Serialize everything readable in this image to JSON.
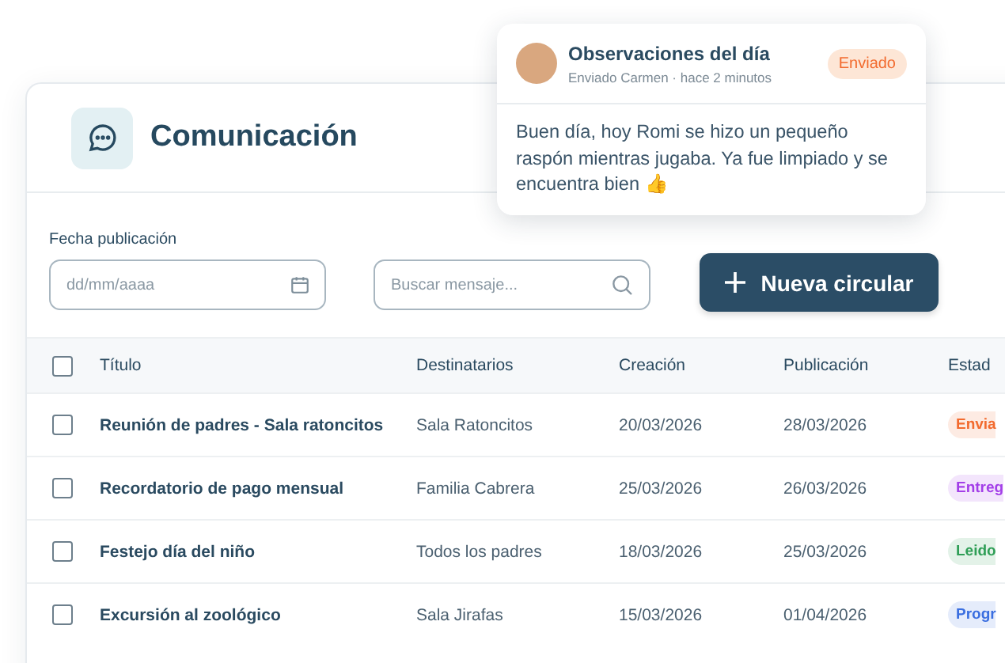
{
  "header": {
    "title": "Comunicación"
  },
  "filters": {
    "date_label": "Fecha publicación",
    "date_placeholder": "dd/mm/aaaa",
    "search_placeholder": "Buscar mensaje...",
    "new_button": "Nueva circular"
  },
  "table": {
    "select_all_checked": false,
    "columns": [
      "Título",
      "Destinatarios",
      "Creación",
      "Publicación",
      "Estad"
    ],
    "rows": [
      {
        "checked": false,
        "title": "Reunión de padres - Sala ratoncitos",
        "recipients": "Sala Ratoncitos",
        "created": "20/03/2026",
        "published": "28/03/2026",
        "status": "Envia",
        "color": "#f26b2f"
      },
      {
        "checked": false,
        "title": "Recordatorio de pago mensual",
        "recipients": "Familia Cabrera",
        "created": "25/03/2026",
        "published": "26/03/2026",
        "status": "Entreg",
        "color": "#a33ee8"
      },
      {
        "checked": false,
        "title": "Festejo día del niño",
        "recipients": "Todos los padres",
        "created": "18/03/2026",
        "published": "25/03/2026",
        "status": "Leido",
        "color": "#2f9e56"
      },
      {
        "checked": false,
        "title": "Excursión al zoológico",
        "recipients": "Sala Jirafas",
        "created": "15/03/2026",
        "published": "01/04/2026",
        "status": "Progr",
        "color": "#3b6fe0"
      }
    ]
  },
  "notification": {
    "title": "Observaciones del día",
    "subtitle": "Enviado Carmen · hace 2 minutos",
    "badge": "Enviado",
    "message": "Buen día, hoy Romi se hizo un pequeño raspón mientras jugaba. Ya fue limpiado y se encuentra bien 👍"
  }
}
